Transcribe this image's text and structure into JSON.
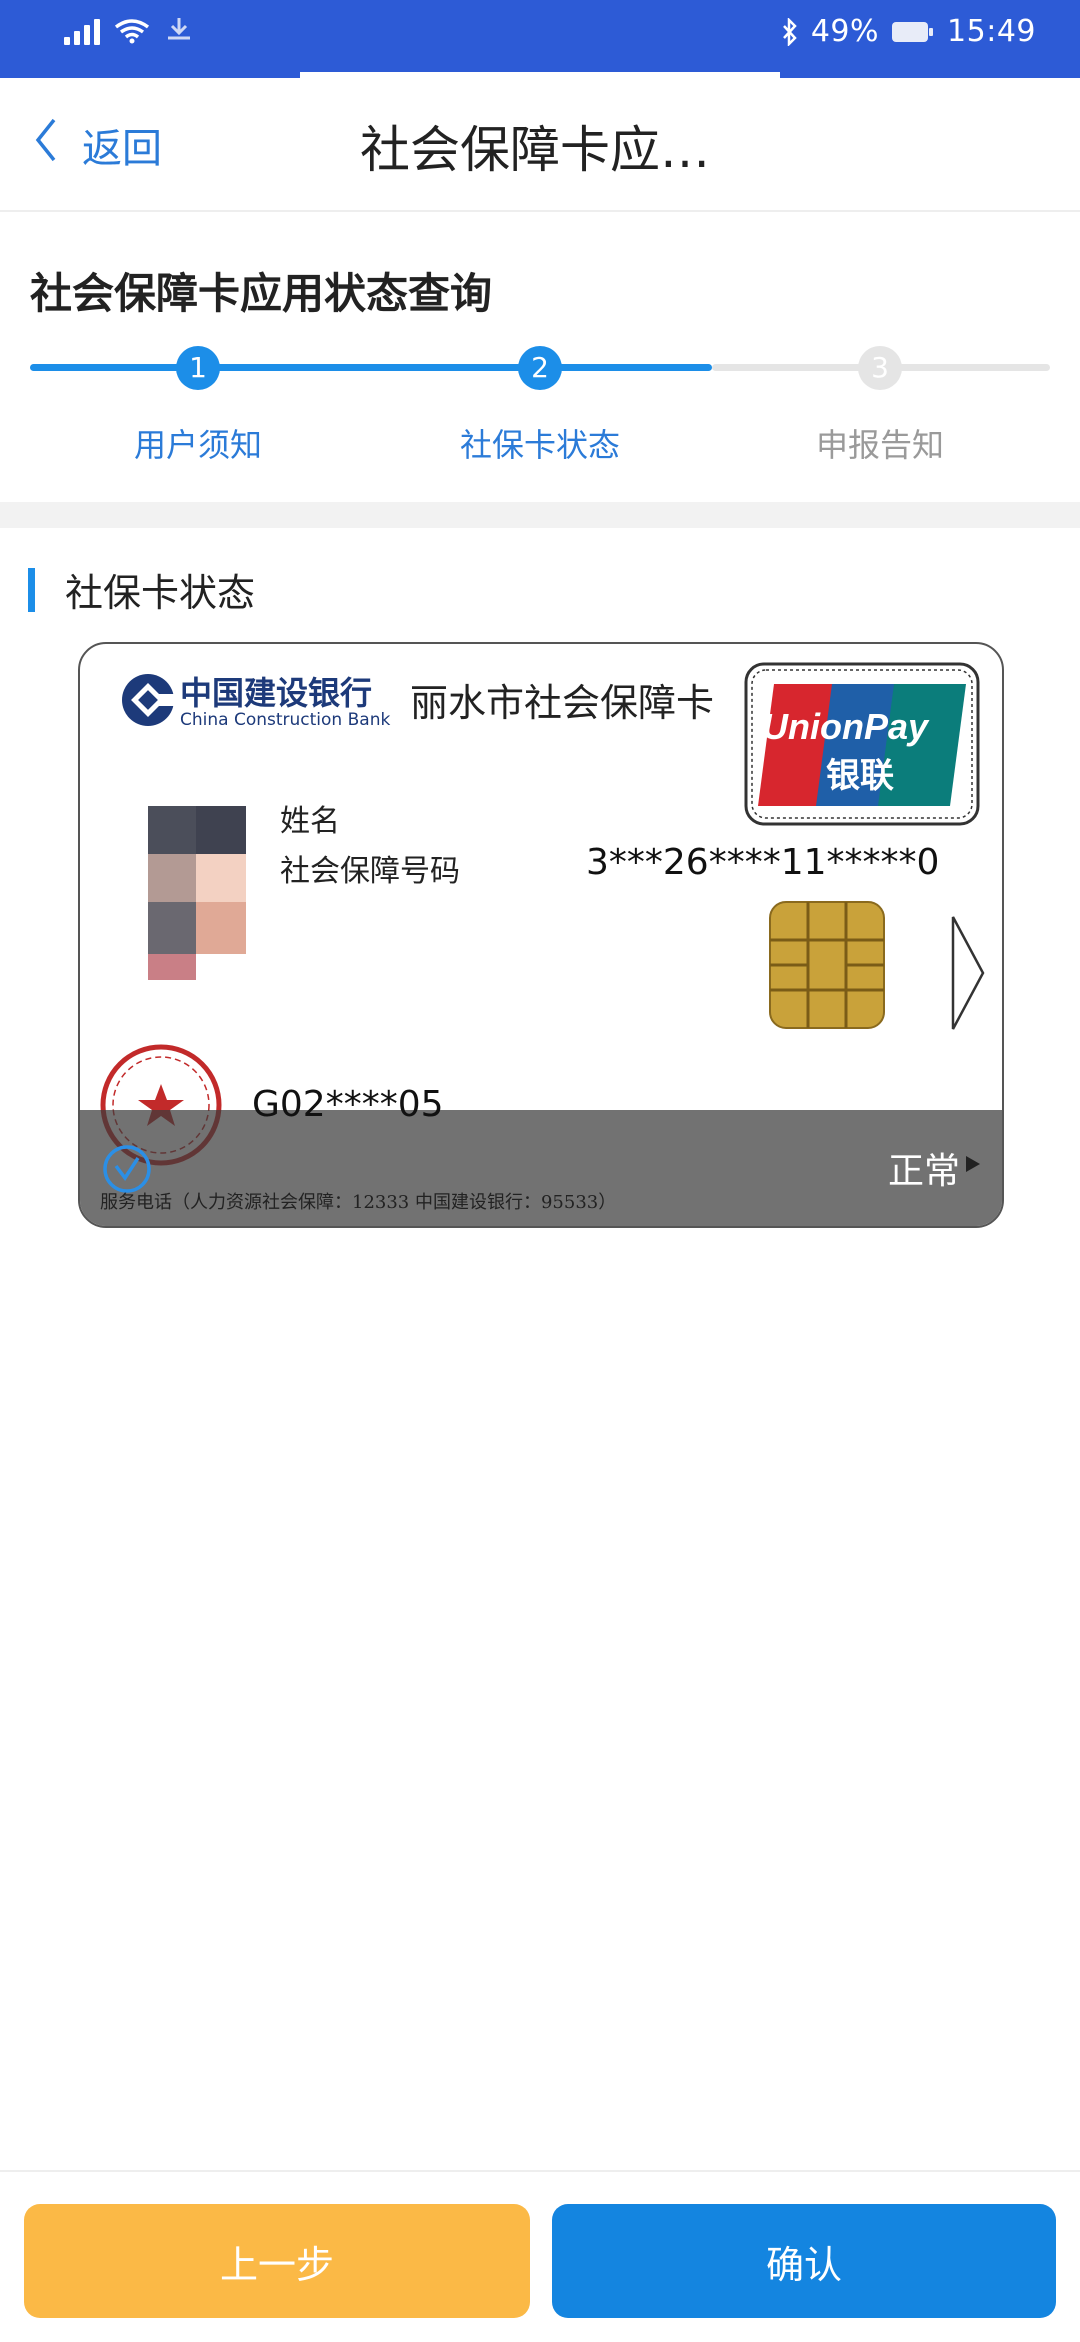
{
  "status_bar": {
    "network_icon": "signal-icon",
    "wifi_icon": "wifi-icon",
    "bluetooth_icon": "bluetooth-icon",
    "battery_text": "49%",
    "battery_icon": "battery-icon",
    "time": "15:49"
  },
  "nav": {
    "back_label": "返回",
    "title": "社会保障卡应…"
  },
  "page": {
    "header": "社会保障卡应用状态查询",
    "steps": [
      {
        "num": "1",
        "label": "用户须知",
        "state": "done"
      },
      {
        "num": "2",
        "label": "社保卡状态",
        "state": "done"
      },
      {
        "num": "3",
        "label": "申报告知",
        "state": "todo"
      }
    ]
  },
  "section": {
    "title": "社保卡状态"
  },
  "card": {
    "bank_name": "中国建设银行",
    "bank_name_en": "China Construction Bank",
    "card_title": "丽水市社会保障卡",
    "unionpay_en": "UnionPay",
    "unionpay_cn": "银联",
    "name_label": "姓名",
    "ssn_label": "社会保障号码",
    "ssn_value": "3***26****11*****0",
    "card_no": "G02****05",
    "status": "正常",
    "service_line": "服务电话（人力资源社会保障：12333    中国建设银行：95533）",
    "colors": {
      "unionpay_red": "#d7262e",
      "unionpay_blue": "#1f5fa8",
      "unionpay_green": "#0b7d7b",
      "chip_gold": "#c9a23a"
    }
  },
  "buttons": {
    "prev": "上一步",
    "confirm": "确认"
  },
  "colors": {
    "primary": "#1c8ee8",
    "status_bar": "#2d5bd6",
    "prev_button": "#fbb946",
    "confirm_button": "#1485e0"
  }
}
